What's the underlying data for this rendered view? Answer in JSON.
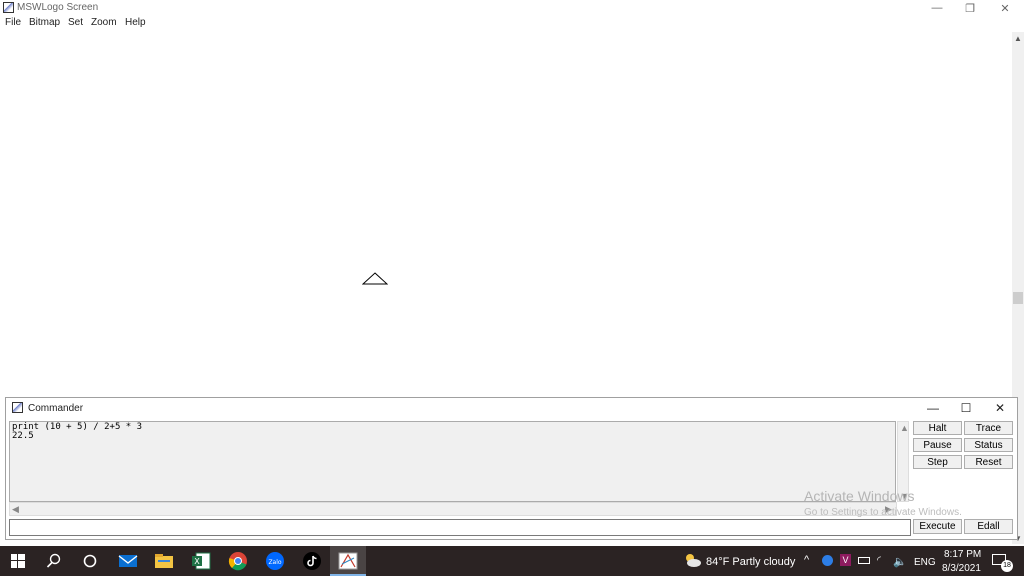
{
  "window": {
    "title": "MSWLogo Screen",
    "controls": {
      "minimize": "—",
      "maximize": "❐",
      "close": "✕"
    }
  },
  "menu": [
    "File",
    "Bitmap",
    "Set",
    "Zoom",
    "Help"
  ],
  "commander": {
    "title": "Commander",
    "controls": {
      "minimize": "—",
      "maximize": "☐",
      "close": "✕"
    },
    "output_lines": "print (10 + 5) / 2+5 * 3\n22.5",
    "input_value": "",
    "buttons": {
      "halt": "Halt",
      "trace": "Trace",
      "pause": "Pause",
      "status": "Status",
      "step": "Step",
      "reset": "Reset",
      "execute": "Execute",
      "edall": "Edall"
    }
  },
  "watermark": {
    "title": "Activate Windows",
    "subtitle": "Go to Settings to activate Windows."
  },
  "taskbar": {
    "pinned": [
      "windows-start-icon",
      "search-icon",
      "task-view-icon",
      "mail-icon",
      "file-explorer-icon",
      "excel-icon",
      "chrome-icon",
      "zalo-icon",
      "tiktok-icon",
      "mswlogo-icon"
    ],
    "zalo_label": "Zalo",
    "weather": "84°F  Partly cloudy",
    "language": "ENG",
    "time": "8:17 PM",
    "date": "8/3/2021",
    "notification_count": "18"
  },
  "colors": {
    "taskbar_bg": "#2b2323",
    "accent": "#0078d7"
  }
}
